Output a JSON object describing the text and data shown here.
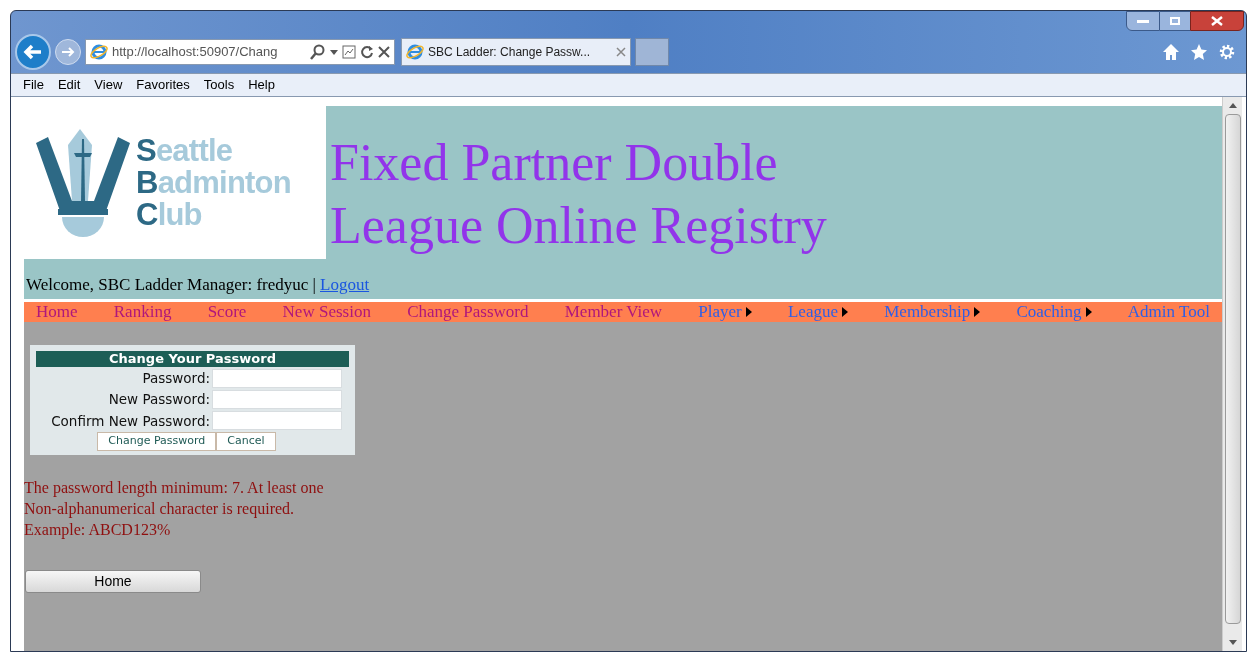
{
  "browser": {
    "address": "http://localhost:50907/Chang",
    "tab_title": "SBC Ladder: Change Passw...",
    "menu": [
      "File",
      "Edit",
      "View",
      "Favorites",
      "Tools",
      "Help"
    ]
  },
  "header": {
    "logo_lines": [
      "Seattle",
      "Badminton",
      "Club"
    ],
    "title_lines": [
      "Fixed Partner Double",
      "League Online Registry"
    ],
    "welcome": "Welcome, SBC Ladder Manager: fredyuc |",
    "logout": "Logout"
  },
  "nav": [
    {
      "label": "Home",
      "visited": true,
      "submenu": false
    },
    {
      "label": "Ranking",
      "visited": true,
      "submenu": false
    },
    {
      "label": "Score",
      "visited": true,
      "submenu": false
    },
    {
      "label": "New Session",
      "visited": true,
      "submenu": false
    },
    {
      "label": "Change Password",
      "visited": true,
      "submenu": false
    },
    {
      "label": "Member View",
      "visited": true,
      "submenu": false
    },
    {
      "label": "Player",
      "visited": false,
      "submenu": true
    },
    {
      "label": "League",
      "visited": false,
      "submenu": true
    },
    {
      "label": "Membership",
      "visited": false,
      "submenu": true
    },
    {
      "label": "Coaching",
      "visited": false,
      "submenu": true
    },
    {
      "label": "Admin Tool",
      "visited": false,
      "submenu": false
    }
  ],
  "form": {
    "title": "Change Your Password",
    "fields": [
      {
        "label": "Password:"
      },
      {
        "label": "New Password:"
      },
      {
        "label": "Confirm New Password:"
      }
    ],
    "buttons": [
      "Change Password",
      "Cancel"
    ]
  },
  "note_lines": [
    "The password length minimum: 7. At least one",
    "Non-alphanumerical character is required.",
    "Example: ABCD123%"
  ],
  "home_button": "Home"
}
